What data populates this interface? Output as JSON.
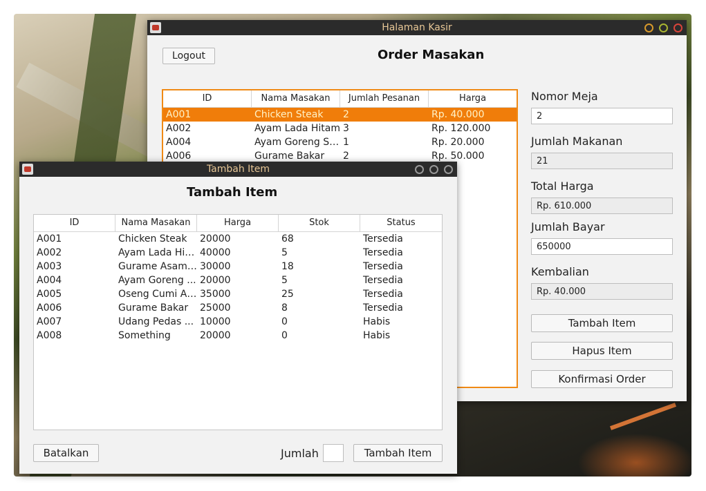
{
  "main_window": {
    "title": "Halaman Kasir",
    "logout_label": "Logout",
    "heading": "Order Masakan",
    "order_table": {
      "columns": [
        "ID",
        "Nama Masakan",
        "Jumlah Pesanan",
        "Harga"
      ],
      "rows": [
        [
          "A001",
          "Chicken Steak",
          "2",
          "Rp. 40.000"
        ],
        [
          "A002",
          "Ayam Lada Hitam",
          "3",
          "Rp. 120.000"
        ],
        [
          "A004",
          "Ayam Goreng Se...",
          "1",
          "Rp. 20.000"
        ],
        [
          "A006",
          "Gurame Bakar",
          "2",
          "Rp. 50.000"
        ]
      ],
      "selected_row": 0
    },
    "nomor_meja_label": "Nomor Meja",
    "nomor_meja_value": "2",
    "jumlah_makanan_label": "Jumlah Makanan",
    "jumlah_makanan_value": "21",
    "total_harga_label": "Total Harga",
    "total_harga_value": "Rp. 610.000",
    "jumlah_bayar_label": "Jumlah Bayar",
    "jumlah_bayar_value": "650000",
    "kembalian_label": "Kembalian",
    "kembalian_value": "Rp. 40.000",
    "tambah_item_label": "Tambah Item",
    "hapus_item_label": "Hapus Item",
    "konfirmasi_order_label": "Konfirmasi Order"
  },
  "dialog": {
    "title": "Tambah Item",
    "heading": "Tambah Item",
    "item_table": {
      "columns": [
        "ID",
        "Nama Masakan",
        "Harga",
        "Stok",
        "Status"
      ],
      "rows": [
        [
          "A001",
          "Chicken Steak",
          "20000",
          "68",
          "Tersedia"
        ],
        [
          "A002",
          "Ayam Lada Hit...",
          "40000",
          "5",
          "Tersedia"
        ],
        [
          "A003",
          "Gurame Asam ...",
          "30000",
          "18",
          "Tersedia"
        ],
        [
          "A004",
          "Ayam Goreng ...",
          "20000",
          "5",
          "Tersedia"
        ],
        [
          "A005",
          "Oseng Cumi As...",
          "35000",
          "25",
          "Tersedia"
        ],
        [
          "A006",
          "Gurame Bakar",
          "25000",
          "8",
          "Tersedia"
        ],
        [
          "A007",
          "Udang Pedas ...",
          "10000",
          "0",
          "Habis"
        ],
        [
          "A008",
          "Something",
          "20000",
          "0",
          "Habis"
        ]
      ]
    },
    "batalkan_label": "Batalkan",
    "jumlah_label": "Jumlah",
    "jumlah_value": "",
    "tambah_item_label": "Tambah Item"
  },
  "colors": {
    "accent": "#f07d0a",
    "titlebar": "#2b2b2b",
    "title_text": "#e8c796"
  },
  "icons": {
    "app": "java-app-icon",
    "window_controls": [
      "minimize-icon",
      "maximize-icon",
      "close-icon"
    ]
  }
}
